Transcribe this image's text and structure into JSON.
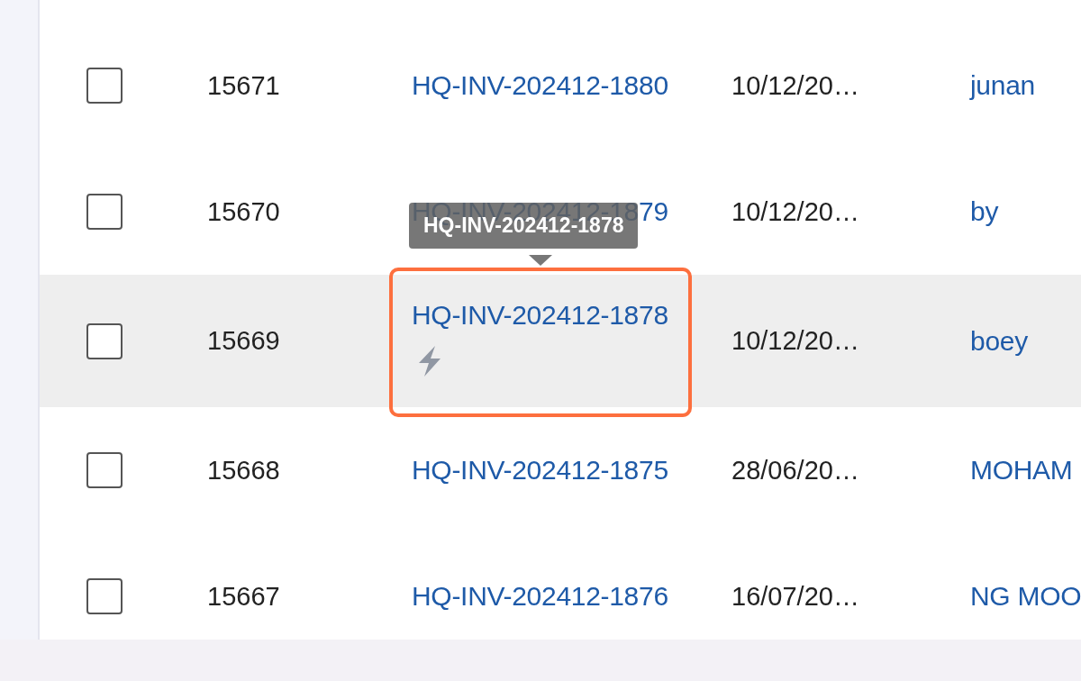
{
  "table": {
    "rows": [
      {
        "checked": false,
        "id": "15671",
        "invoice": "HQ-INV-202412-1880",
        "date": "10/12/20…",
        "name": "junan",
        "hovered": false,
        "flagged": false
      },
      {
        "checked": false,
        "id": "15670",
        "invoice": "HQ-INV-202412-1879",
        "date": "10/12/20…",
        "name": "by",
        "hovered": false,
        "flagged": false
      },
      {
        "checked": false,
        "id": "15669",
        "invoice": "HQ-INV-202412-1878",
        "date": "10/12/20…",
        "name": "boey",
        "hovered": true,
        "flagged": true,
        "tooltip": "HQ-INV-202412-1878"
      },
      {
        "checked": false,
        "id": "15668",
        "invoice": "HQ-INV-202412-1875",
        "date": "28/06/20…",
        "name": "MOHAM",
        "hovered": false,
        "flagged": false
      },
      {
        "checked": false,
        "id": "15667",
        "invoice": "HQ-INV-202412-1876",
        "date": "16/07/20…",
        "name": "NG MOO",
        "hovered": false,
        "flagged": false
      }
    ]
  }
}
